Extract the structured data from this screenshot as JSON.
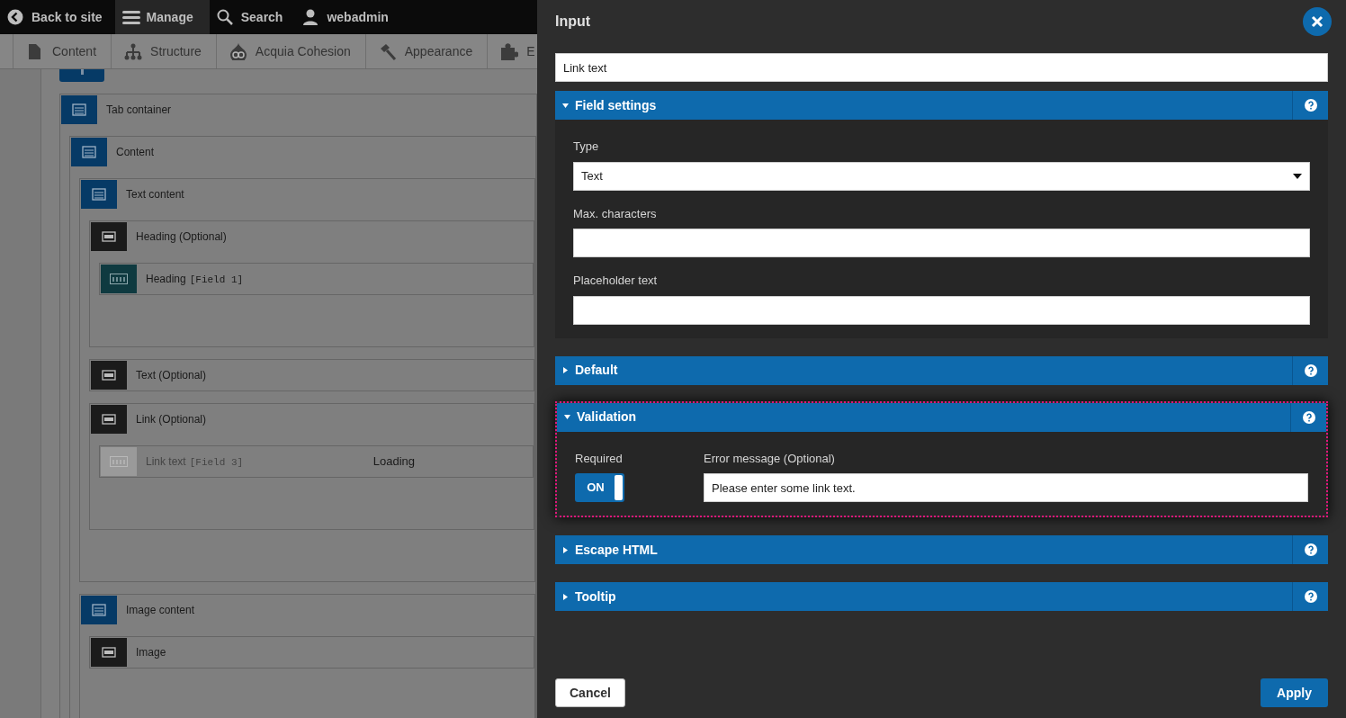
{
  "toolbar": {
    "items": [
      {
        "label": "Back to site",
        "kind": "back",
        "selected": false
      },
      {
        "label": "Manage",
        "kind": "menu",
        "selected": true
      },
      {
        "label": "Search",
        "kind": "search",
        "selected": false
      },
      {
        "label": "webadmin",
        "kind": "user",
        "selected": false
      }
    ]
  },
  "admin_menu": {
    "items": [
      {
        "label": "Content",
        "kind": "file"
      },
      {
        "label": "Structure",
        "kind": "sitemap"
      },
      {
        "label": "Acquia Cohesion",
        "kind": "drop"
      },
      {
        "label": "Appearance",
        "kind": "hammer"
      },
      {
        "label": "E",
        "kind": "puzzle"
      }
    ]
  },
  "layout_tree": [
    {
      "label": "Tab container",
      "kind": "container",
      "children": [
        {
          "label": "Content",
          "kind": "container",
          "children": [
            {
              "label": "Text content",
              "kind": "container",
              "children": [
                {
                  "label": "Heading (Optional)",
                  "kind": "slot",
                  "children": [
                    {
                      "label": "Heading",
                      "tag": "[Field 1]",
                      "kind": "field",
                      "disabled": false
                    }
                  ]
                },
                {
                  "label": "Text (Optional)",
                  "kind": "slot"
                },
                {
                  "label": "Link (Optional)",
                  "kind": "slot",
                  "children": [
                    {
                      "label": "Link text",
                      "tag": "[Field 3]",
                      "kind": "field",
                      "disabled": true,
                      "status": "Loading"
                    }
                  ]
                }
              ]
            },
            {
              "label": "Image content",
              "kind": "container",
              "children": [
                {
                  "label": "Image",
                  "kind": "slot"
                }
              ]
            }
          ]
        }
      ]
    }
  ],
  "panel": {
    "title": "Input",
    "name_field": {
      "value": "Link text"
    },
    "sections": [
      {
        "title": "Field settings",
        "expanded": true,
        "highlighted": false,
        "fields": [
          {
            "kind": "select",
            "label": "Type",
            "value": "Text"
          },
          {
            "kind": "text",
            "label": "Max. characters"
          },
          {
            "kind": "text",
            "label": "Placeholder text"
          }
        ]
      },
      {
        "title": "Default",
        "expanded": false,
        "highlighted": false
      },
      {
        "title": "Validation",
        "expanded": true,
        "highlighted": true,
        "fields": [
          {
            "kind": "toggle",
            "label": "Required",
            "on": true,
            "text": "ON"
          },
          {
            "kind": "text",
            "label": "Error message (Optional)",
            "value": "Please enter some link text."
          }
        ]
      },
      {
        "title": "Escape HTML",
        "expanded": false,
        "highlighted": false
      },
      {
        "title": "Tooltip",
        "expanded": false,
        "highlighted": false
      }
    ],
    "cancel": "Cancel",
    "apply": "Apply"
  }
}
